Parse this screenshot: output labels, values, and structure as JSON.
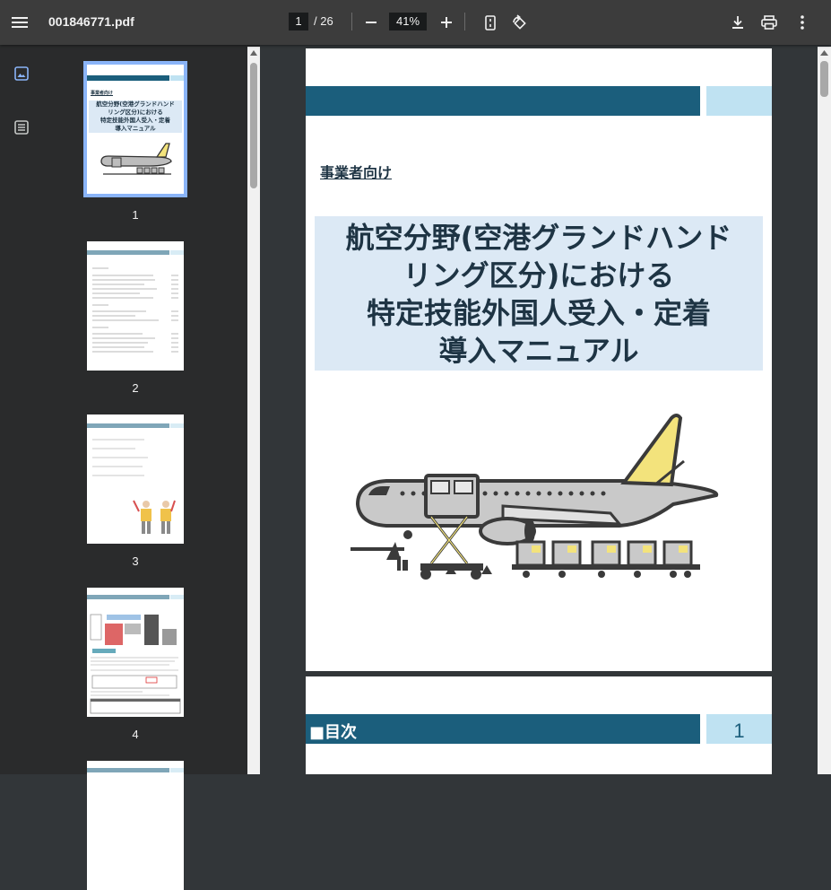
{
  "toolbar": {
    "filename": "001846771.pdf",
    "page_current": "1",
    "page_total": "/ 26",
    "zoom": "41%",
    "icons": [
      "menu-icon",
      "zoom-out-icon",
      "zoom-in-icon",
      "fit-page-icon",
      "rotate-icon",
      "download-icon",
      "print-icon",
      "more-icon"
    ]
  },
  "sidebar": {
    "rail_icons": [
      "thumbnail-view-icon",
      "outline-view-icon"
    ],
    "thumbnails": [
      {
        "num": "1",
        "active": true
      },
      {
        "num": "2",
        "active": false
      },
      {
        "num": "3",
        "active": false
      },
      {
        "num": "4",
        "active": false
      }
    ]
  },
  "page1": {
    "subtitle": "事業者向け",
    "title_lines": [
      "航空分野(空港グランドハンド",
      "リング区分)における",
      "特定技能外国人受入・定着",
      "導入マニュアル"
    ],
    "thumb_subtitle": "事業者向け",
    "thumb_title_lines": [
      "航空分野(空港グランドハンド",
      "リング区分)における",
      "特定技能外国人受入・定着",
      "導入マニュアル"
    ]
  },
  "page2": {
    "heading": "■目次",
    "page_number": "1"
  },
  "colors": {
    "band_dark": "#1b5e7c",
    "band_light": "#bfe2f2",
    "title_bg": "#dce9f5",
    "accent_yellow": "#f3e37c"
  }
}
